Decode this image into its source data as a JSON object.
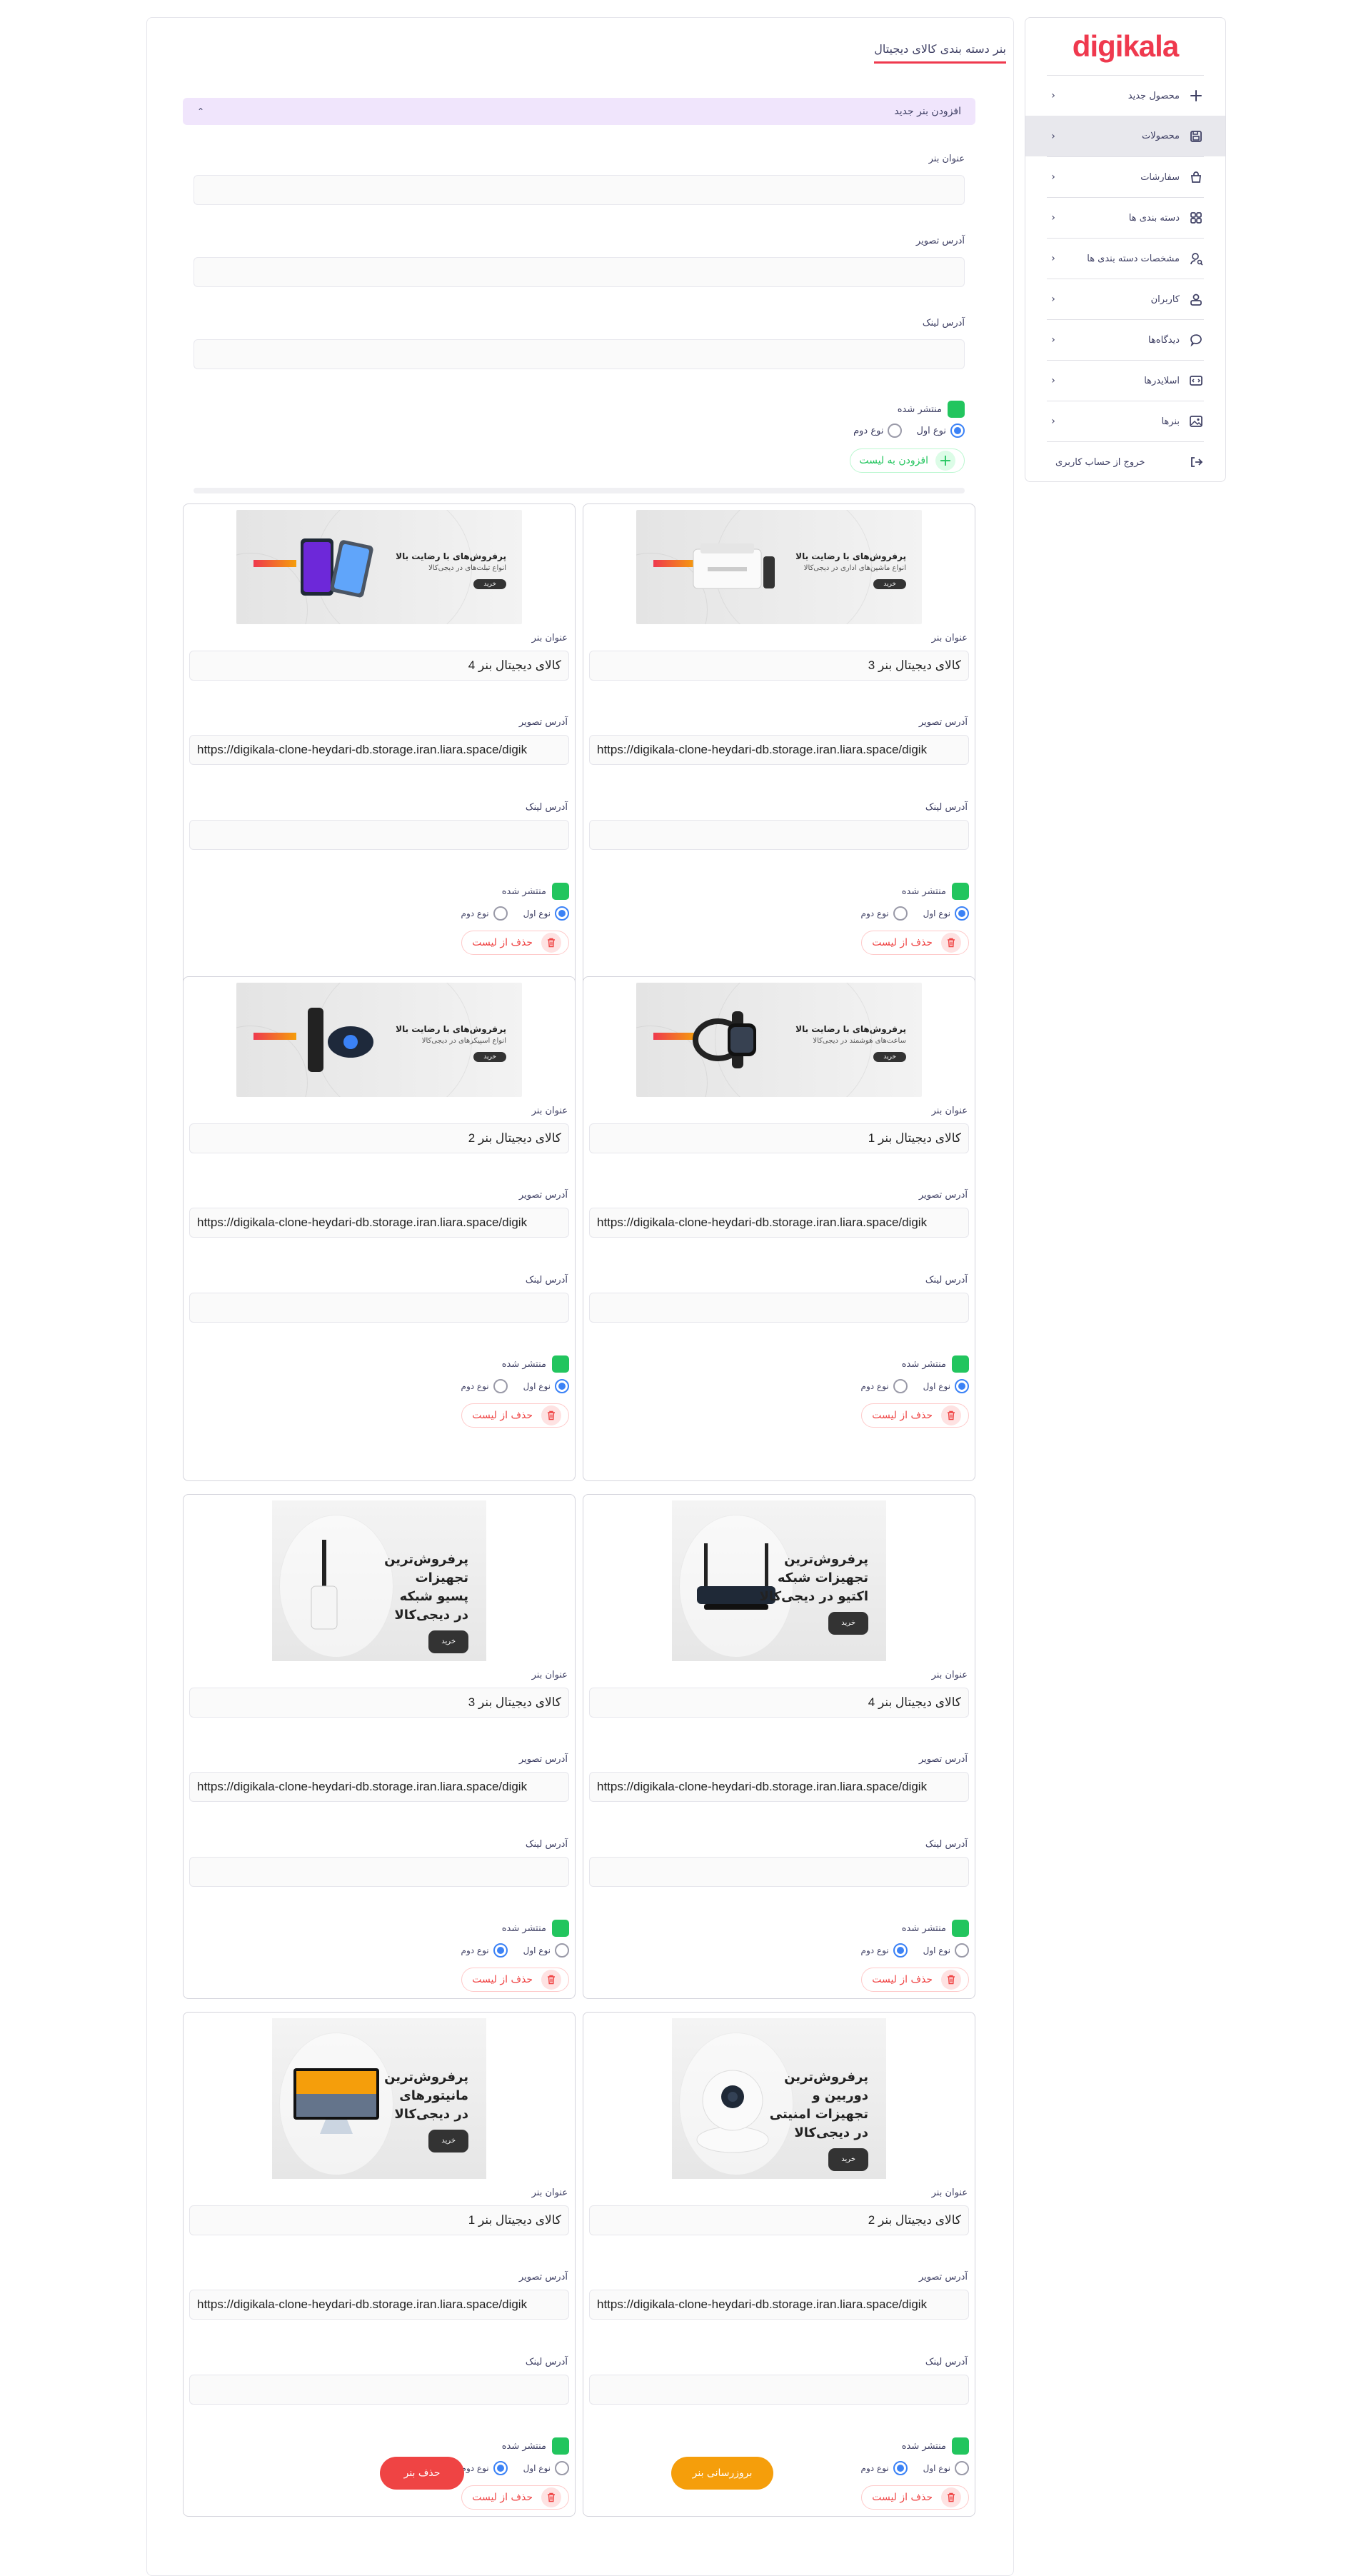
{
  "brand": {
    "logo_text": "digikala",
    "color": "#ef394e"
  },
  "sidebar": {
    "items": [
      {
        "label": "محصول جدید",
        "icon": "plus-icon",
        "active": false
      },
      {
        "label": "محصولات",
        "icon": "save-icon",
        "active": true
      },
      {
        "label": "سفارشات",
        "icon": "shopping-bag-icon",
        "active": false
      },
      {
        "label": "دسته بندی ها",
        "icon": "grid-icon",
        "active": false
      },
      {
        "label": "مشخصات دسته بندی ها",
        "icon": "user-search-icon",
        "active": false
      },
      {
        "label": "کاربران",
        "icon": "user-badge-icon",
        "active": false
      },
      {
        "label": "دیدگاه‌ها",
        "icon": "comment-icon",
        "active": false
      },
      {
        "label": "اسلایدرها",
        "icon": "slider-icon",
        "active": false
      },
      {
        "label": "بنرها",
        "icon": "image-icon",
        "active": false
      }
    ],
    "logout_label": "خروج از حساب کاربری"
  },
  "page": {
    "title": "بنر دسته بندی کالای دیجیتال"
  },
  "new_banner": {
    "accordion_label": "افزودن بنر جدید",
    "title_label": "عنوان بنر",
    "image_label": "آدرس تصویر",
    "link_label": "آدرس لینک",
    "published_label": "منتشر شده",
    "type1_label": "نوع اول",
    "type2_label": "نوع دوم",
    "selected_type": 1,
    "add_button_label": "افزودن به لیست"
  },
  "card_labels": {
    "title_label": "عنوان بنر",
    "image_label": "آدرس تصویر",
    "link_label": "آدرس لینک",
    "published_label": "منتشر شده",
    "type1_label": "نوع اول",
    "type2_label": "نوع دوم",
    "delete_label": "حذف از لیست"
  },
  "banners": [
    {
      "title": "کالای دیجیتال بنر 3",
      "image_url": "https://digikala-clone-heydari-db.storage.iran.liara.space/digik",
      "link": "",
      "published": true,
      "type": 1,
      "art": {
        "kind": "wide",
        "headline": "پرفروش‌های با رضایت بالا",
        "sub": "انواع ماشین‌های اداری در دیجی‌کالا",
        "cta": "خرید",
        "product": "printer"
      }
    },
    {
      "title": "کالای دیجیتال بنر 4",
      "image_url": "https://digikala-clone-heydari-db.storage.iran.liara.space/digik",
      "link": "",
      "published": true,
      "type": 1,
      "art": {
        "kind": "wide",
        "headline": "پرفروش‌های با رضایت بالا",
        "sub": "انواع تبلت‌های در دیجی‌کالا",
        "cta": "خرید",
        "product": "tablets"
      }
    },
    {
      "title": "کالای دیجیتال بنر 1",
      "image_url": "https://digikala-clone-heydari-db.storage.iran.liara.space/digik",
      "link": "",
      "published": true,
      "type": 1,
      "art": {
        "kind": "wide",
        "headline": "پرفروش‌های با رضایت بالا",
        "sub": "ساعت‌های هوشمند در دیجی‌کالا",
        "cta": "خرید",
        "product": "watches"
      }
    },
    {
      "title": "کالای دیجیتال بنر 2",
      "image_url": "https://digikala-clone-heydari-db.storage.iran.liara.space/digik",
      "link": "",
      "published": true,
      "type": 1,
      "art": {
        "kind": "wide",
        "headline": "پرفروش‌های با رضایت بالا",
        "sub": "انواع اسپیکرهای در دیجی‌کالا",
        "cta": "خرید",
        "product": "speaker"
      }
    },
    {
      "title": "کالای دیجیتال بنر 4",
      "image_url": "https://digikala-clone-heydari-db.storage.iran.liara.space/digik",
      "link": "",
      "published": true,
      "type": 2,
      "art": {
        "kind": "square",
        "lines": [
          "پرفروش‌ترین",
          "تجهیزات شبکه",
          "اکتیو در دیجی‌کالا"
        ],
        "cta": "خرید",
        "product": "router"
      }
    },
    {
      "title": "کالای دیجیتال بنر 3",
      "image_url": "https://digikala-clone-heydari-db.storage.iran.liara.space/digik",
      "link": "",
      "published": true,
      "type": 2,
      "art": {
        "kind": "square",
        "lines": [
          "پرفروش‌ترین",
          "تجهیزات",
          "پسیو شبکه",
          "در دیجی‌کالا"
        ],
        "cta": "خرید",
        "product": "adapter"
      }
    },
    {
      "title": "کالای دیجیتال بنر 2",
      "image_url": "https://digikala-clone-heydari-db.storage.iran.liara.space/digik",
      "link": "",
      "published": true,
      "type": 2,
      "art": {
        "kind": "square",
        "lines": [
          "پرفروش‌ترین",
          "دوربین و",
          "تجهیزات امنیتی",
          "در دیجی‌کالا"
        ],
        "cta": "خرید",
        "product": "camera"
      }
    },
    {
      "title": "کالای دیجیتال بنر 1",
      "image_url": "https://digikala-clone-heydari-db.storage.iran.liara.space/digik",
      "link": "",
      "published": true,
      "type": 2,
      "art": {
        "kind": "square",
        "lines": [
          "پرفروش‌ترین",
          "مانیتورهای",
          "در دیجی‌کالا"
        ],
        "cta": "خرید",
        "product": "monitor"
      }
    }
  ],
  "actions": {
    "update_label": "بروزرسانی بنر",
    "delete_label": "حذف بنر"
  },
  "colors": {
    "accent": "#ef394e",
    "published": "#22c55e",
    "radio": "#3b82f6",
    "update": "#f59e0b",
    "delete": "#ef4444",
    "accordion_bg": "#f0e5fc"
  }
}
